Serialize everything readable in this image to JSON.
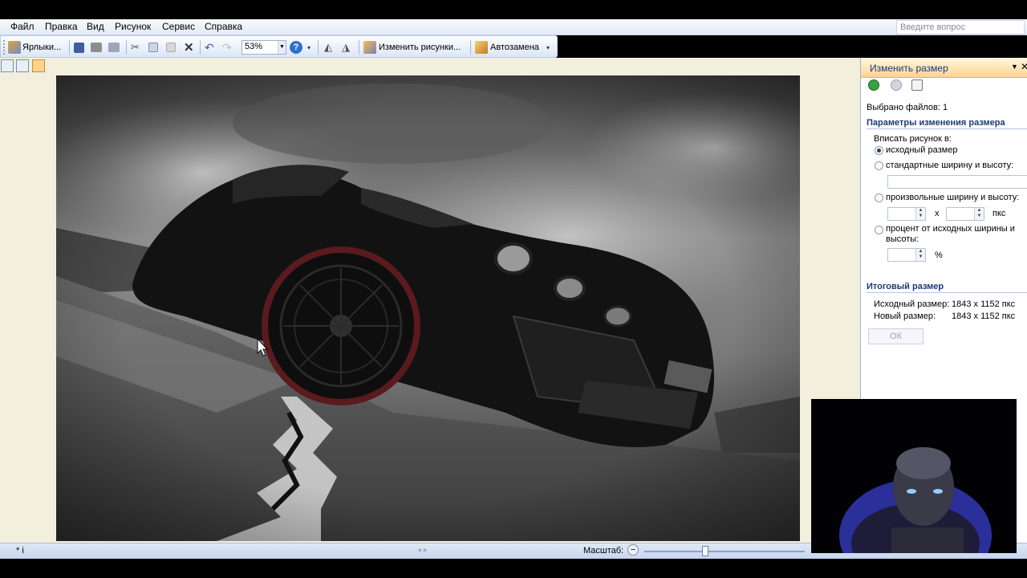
{
  "menu": [
    "Файл",
    "Правка",
    "Вид",
    "Рисунок",
    "Сервис",
    "Справка"
  ],
  "ask_placeholder": "Введите вопрос",
  "toolbar": {
    "shortcuts_label": "Ярлыки...",
    "zoom_value": "53%",
    "edit_pictures_label": "Изменить рисунки...",
    "autocorrect_label": "Автозамена"
  },
  "pane": {
    "title": "Изменить размер",
    "selected_files": "Выбрано файлов: 1",
    "params_title": "Параметры изменения размера",
    "fit_label": "Вписать рисунок в:",
    "options": [
      {
        "label": "исходный размер",
        "selected": true
      },
      {
        "label": "стандартные ширину и высоту:",
        "selected": false
      },
      {
        "label": "произвольные ширину и высоту:",
        "selected": false
      },
      {
        "label": "процент от исходных ширины и",
        "label2": "высоты:",
        "selected": false
      }
    ],
    "x_sign": "x",
    "px_unit": "пкс",
    "percent_unit": "%",
    "result_title": "Итоговый размер",
    "original_label": "Исходный размер:",
    "original_value": "1843 x 1152 пкс",
    "new_label": "Новый размер:",
    "new_value": "1843 x 1152 пкс",
    "ok_label": "ОК"
  },
  "status": {
    "left_text": "* i",
    "zoom_label": "Масштаб:",
    "zoom_fraction": 0.38
  },
  "colors": {
    "pane_header": "#fbd48f",
    "canvas_bg": "#f2efdd",
    "accent_blue": "#1a3a78"
  }
}
